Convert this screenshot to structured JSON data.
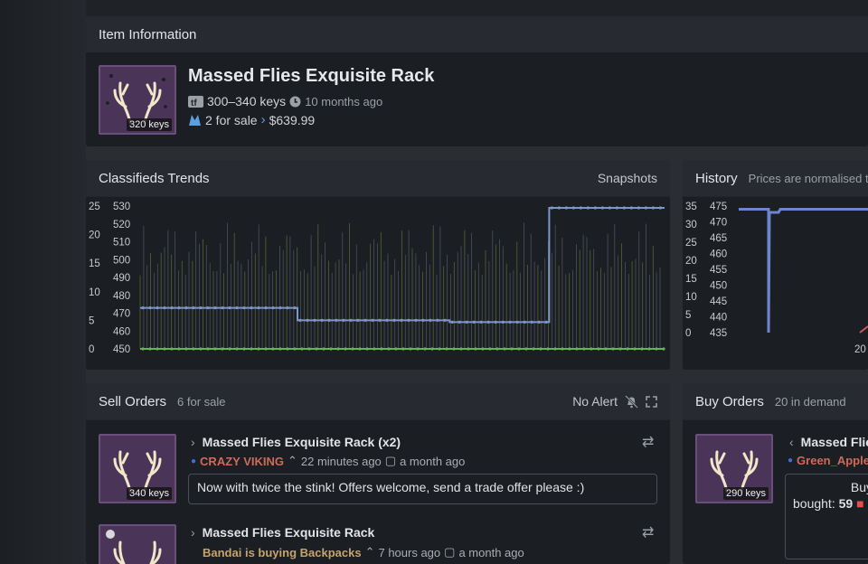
{
  "item_info": {
    "panel_title": "Item Information",
    "name": "Massed Flies Exquisite Rack",
    "image_badge": "320 keys",
    "price_keys": "300–340 keys",
    "price_age": "10 months ago",
    "for_sale": "2 for sale",
    "market_price": "$639.99"
  },
  "trends": {
    "panel_title": "Classifieds Trends",
    "snapshots_label": "Snapshots"
  },
  "history": {
    "panel_title": "History",
    "subtitle": "Prices are normalised t",
    "x_tick_partial": "20"
  },
  "chart_data": [
    {
      "type": "line",
      "title": "Classifieds Trends",
      "y_left_ticks": [
        0,
        5,
        10,
        15,
        20,
        25
      ],
      "y_right_ticks": [
        450,
        460,
        470,
        480,
        490,
        500,
        510,
        520,
        530
      ],
      "ylim_left": [
        0,
        25
      ],
      "ylim_right": [
        450,
        530
      ],
      "series": [
        {
          "axis": "right",
          "color": "#7f96c8",
          "steps": [
            [
              0,
              0.3,
              473
            ],
            [
              0.3,
              0.59,
              466
            ],
            [
              0.59,
              0.78,
              465
            ],
            [
              0.78,
              1.0,
              529
            ]
          ]
        },
        {
          "axis": "right",
          "color": "#6bb34f",
          "steps": [
            [
              0,
              1.0,
              450
            ]
          ]
        }
      ]
    },
    {
      "type": "line",
      "title": "History",
      "y_left_ticks": [
        0,
        5,
        10,
        15,
        20,
        25,
        30,
        35
      ],
      "y_right_ticks": [
        435,
        440,
        445,
        450,
        455,
        460,
        465,
        470,
        475
      ],
      "ylim_right": [
        435,
        475
      ]
    }
  ],
  "sell_orders": {
    "panel_title": "Sell Orders",
    "count_label": "6 for sale",
    "alert_label": "No Alert",
    "orders": [
      {
        "title": "Massed Flies Exquisite Rack (x2)",
        "seller": "CRAZY VIKING",
        "seller_color": "#cf6a5a",
        "bumped": "22 minutes ago",
        "listed": "a month ago",
        "badge": "340 keys",
        "message": "Now with twice the stink! Offers welcome, send a trade offer please :)"
      },
      {
        "title": "Massed Flies Exquisite Rack",
        "seller": "Bandai is buying Backpacks",
        "seller_color": "#c8a36a",
        "bumped": "7 hours ago",
        "listed": "a month ago"
      }
    ]
  },
  "buy_orders": {
    "panel_title": "Buy Orders",
    "count_label": "20 in demand",
    "orders": [
      {
        "title": "Massed Flie",
        "buyer": "Green_Apple",
        "badge": "290 keys",
        "box_line1": "Buy",
        "box_line2_label": "bought:",
        "box_line2_value": "59"
      }
    ]
  }
}
